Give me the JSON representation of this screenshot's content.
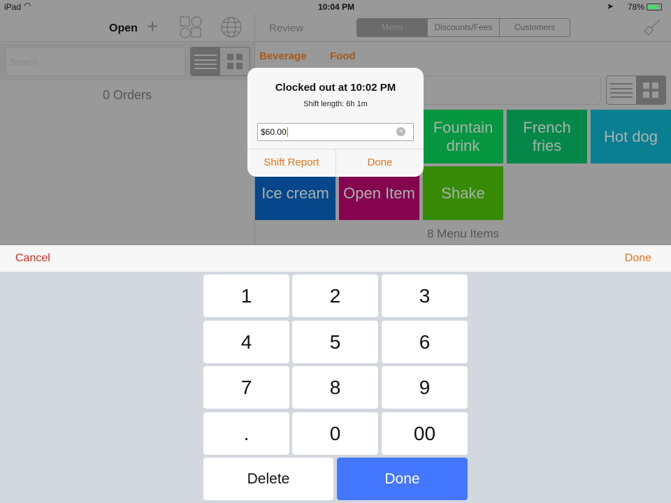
{
  "status": {
    "device": "iPad",
    "time": "10:04 PM",
    "battery": "78%"
  },
  "left": {
    "title": "Open",
    "search_placeholder": "Search",
    "orders_count": "0 Orders"
  },
  "right": {
    "review": "Review",
    "tabs": [
      "Menu",
      "Discounts/Fees",
      "Customers"
    ],
    "categories": [
      "Beverage",
      "Food"
    ],
    "menu_count": "8 Menu Items",
    "tiles": [
      {
        "label": "Fountain drink",
        "color": "#06963f"
      },
      {
        "label": "French fries",
        "color": "#06874a"
      },
      {
        "label": "Hot dog",
        "color": "#0a7f92"
      },
      {
        "label": "Ice cream",
        "color": "#05478a"
      },
      {
        "label": "Open Item",
        "color": "#84044f"
      },
      {
        "label": "Shake",
        "color": "#368a05"
      }
    ]
  },
  "dialog": {
    "title": "Clocked out at 10:02 PM",
    "subtitle": "Shift length: 6h 1m",
    "value": "$60.00",
    "shift_report": "Shift Report",
    "done": "Done"
  },
  "toolbar": {
    "cancel": "Cancel",
    "done": "Done"
  },
  "keypad": {
    "keys": [
      "1",
      "2",
      "3",
      "4",
      "5",
      "6",
      "7",
      "8",
      "9",
      ".",
      "0",
      "00"
    ],
    "delete": "Delete",
    "done": "Done",
    "done_color": "#4477ff"
  },
  "accent": "#e8731c"
}
